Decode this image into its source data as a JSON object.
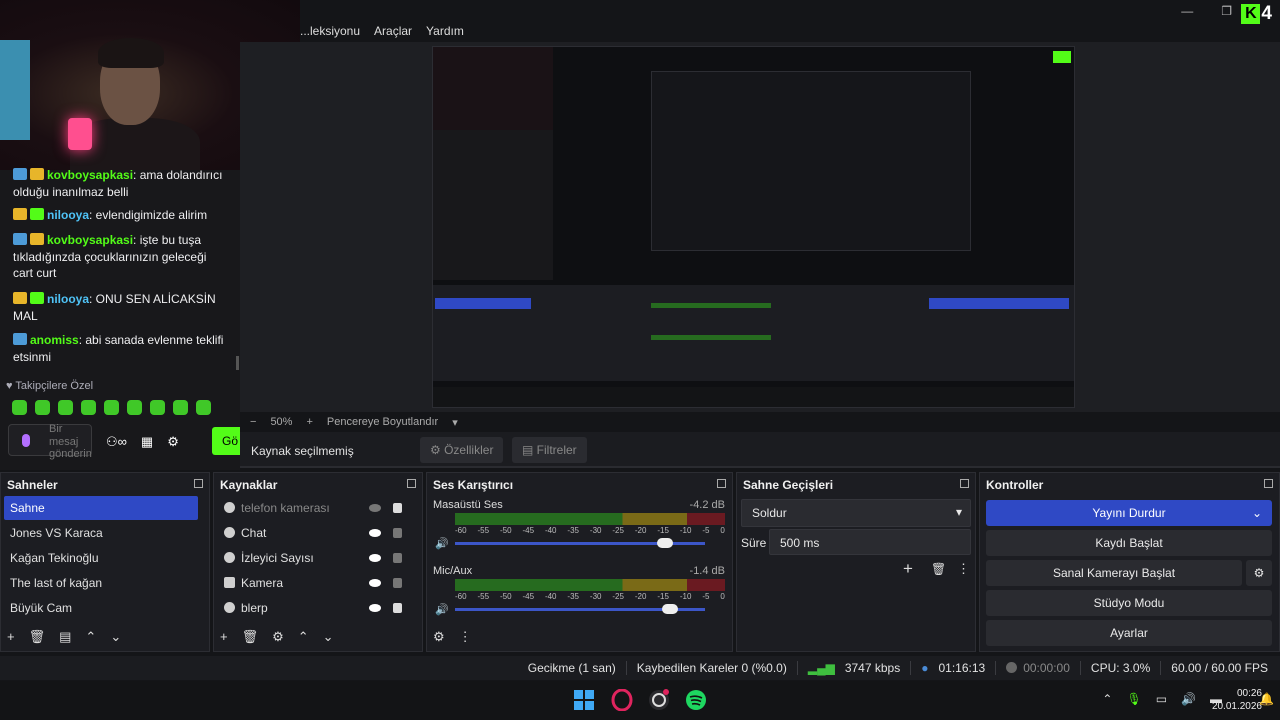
{
  "menu": [
    "...leksiyonu",
    "Araçlar",
    "Yardım"
  ],
  "brand": {
    "letter": "K",
    "badge": "4"
  },
  "chat": {
    "messages": [
      {
        "user": "",
        "text": "olduğu inanılmaz belli",
        "badges": []
      },
      {
        "user": "nilooya",
        "text": ": evlendigimizde alirim",
        "badges": [
          "gold",
          "green"
        ]
      },
      {
        "user": "kovboysapkasi",
        "text": ": işte bu tuşa tıkladığınzda çocuklarınızın geleceği cart curt",
        "badges": [
          "blue",
          "gold"
        ]
      },
      {
        "user": "nilooya",
        "text": ": ONU SEN ALİCAKSİN MAL",
        "badges": [
          "gold",
          "green"
        ]
      },
      {
        "user": "anomiss",
        "text": ": abi sanada evlenme teklifi etsinmi",
        "badges": [
          "blue"
        ]
      }
    ],
    "first_user": "kovboysapkasi",
    "first_text": ": ama dolandırıcı",
    "followers_label": "Takipçilere Özel",
    "input_placeholder": "Bir mesaj gönderin",
    "send_label": "Gö"
  },
  "preview": {
    "zoom_minus": "−",
    "zoom": "50%",
    "zoom_plus": "+",
    "fit_label": "Pencereye Boyutlandır"
  },
  "context": {
    "no_source": "Kaynak seçilmemiş",
    "properties": "Özellikler",
    "filters": "Filtreler"
  },
  "scenes": {
    "title": "Sahneler",
    "items": [
      "Sahne",
      "Jones VS Karaca",
      "Kağan Tekinoğlu",
      "The last of kağan",
      "Büyük Cam"
    ],
    "selected": 0
  },
  "sources": {
    "title": "Kaynaklar",
    "items": [
      {
        "name": "telefon kamerası",
        "hidden": true,
        "locked": true
      },
      {
        "name": "Chat",
        "hidden": false,
        "locked": false
      },
      {
        "name": "İzleyici Sayısı",
        "hidden": false,
        "locked": false
      },
      {
        "name": "Kamera",
        "hidden": false,
        "locked": false
      },
      {
        "name": "blerp",
        "hidden": false,
        "locked": true
      }
    ]
  },
  "mixer": {
    "title": "Ses Karıştırıcı",
    "channels": [
      {
        "name": "Masaüstü Ses",
        "db": "-4.2 dB",
        "level": 0.84
      },
      {
        "name": "Mic/Aux",
        "db": "-1.4 dB",
        "level": 0.86
      }
    ],
    "scale": [
      "-60",
      "-55",
      "-50",
      "-45",
      "-40",
      "-35",
      "-30",
      "-25",
      "-20",
      "-15",
      "-10",
      "-5",
      "0"
    ]
  },
  "transitions": {
    "title": "Sahne Geçişleri",
    "selected": "Soldur",
    "duration_label": "Süre",
    "duration_value": "500 ms"
  },
  "controls": {
    "title": "Kontroller",
    "stop_stream": "Yayını Durdur",
    "start_record": "Kaydı Başlat",
    "virtual_cam": "Sanal Kamerayı Başlat",
    "studio": "Stüdyo Modu",
    "settings": "Ayarlar"
  },
  "status": {
    "delay": "Gecikme (1 san)",
    "dropped": "Kaybedilen Kareler 0 (%0.0)",
    "bitrate": "3747 kbps",
    "stream_time": "01:16:13",
    "record_time": "00:00:00",
    "cpu": "CPU: 3.0%",
    "fps": "60.00 / 60.00 FPS"
  },
  "clock": {
    "time": "00:26",
    "date": "20.01.2026"
  },
  "colors": {
    "accent": "#2f49c5",
    "kick_green": "#53fc18",
    "live_red": "#e0245e"
  }
}
